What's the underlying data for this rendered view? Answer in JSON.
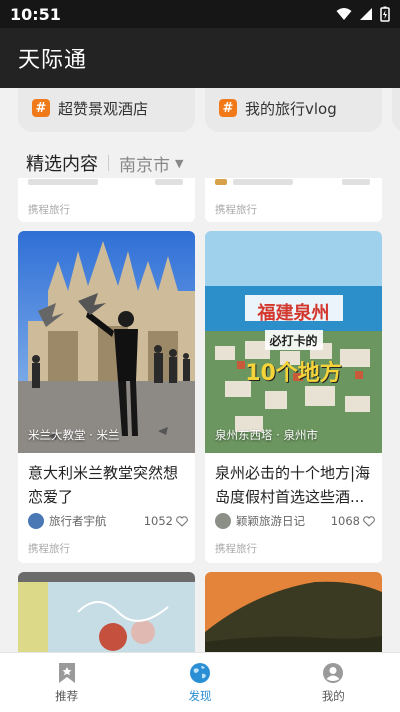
{
  "status": {
    "time": "10:51"
  },
  "app": {
    "title": "天际通"
  },
  "topics": [
    {
      "label": "超赞景观酒店"
    },
    {
      "label": "我的旅行vlog"
    }
  ],
  "section": {
    "title": "精选内容",
    "city": "南京市"
  },
  "cards": [
    {
      "title": "意大利米兰教堂突然想恋爱了",
      "location": "米兰大教堂 · 米兰",
      "author": "旅行者宇航",
      "likes": "1052",
      "source": "携程旅行"
    },
    {
      "title": "泉州必击的十个地方|海岛度假村首选这些酒...",
      "location": "泉州东西塔 · 泉州市",
      "author": "颖颖旅游日记",
      "likes": "1068",
      "source": "携程旅行",
      "image_caption_top": "福建泉州",
      "image_caption_mid": "必打卡的",
      "image_caption_big": "10个地方"
    }
  ],
  "top_partial_cards": [
    {
      "source": "携程旅行"
    },
    {
      "source": "携程旅行"
    }
  ],
  "tabs": [
    {
      "label": "推荐",
      "icon": "bookmark-icon"
    },
    {
      "label": "发现",
      "icon": "globe-icon"
    },
    {
      "label": "我的",
      "icon": "profile-icon"
    }
  ],
  "colors": {
    "accent": "#2a8fd4",
    "hash": "#f07a1a",
    "appbar": "#232323"
  }
}
